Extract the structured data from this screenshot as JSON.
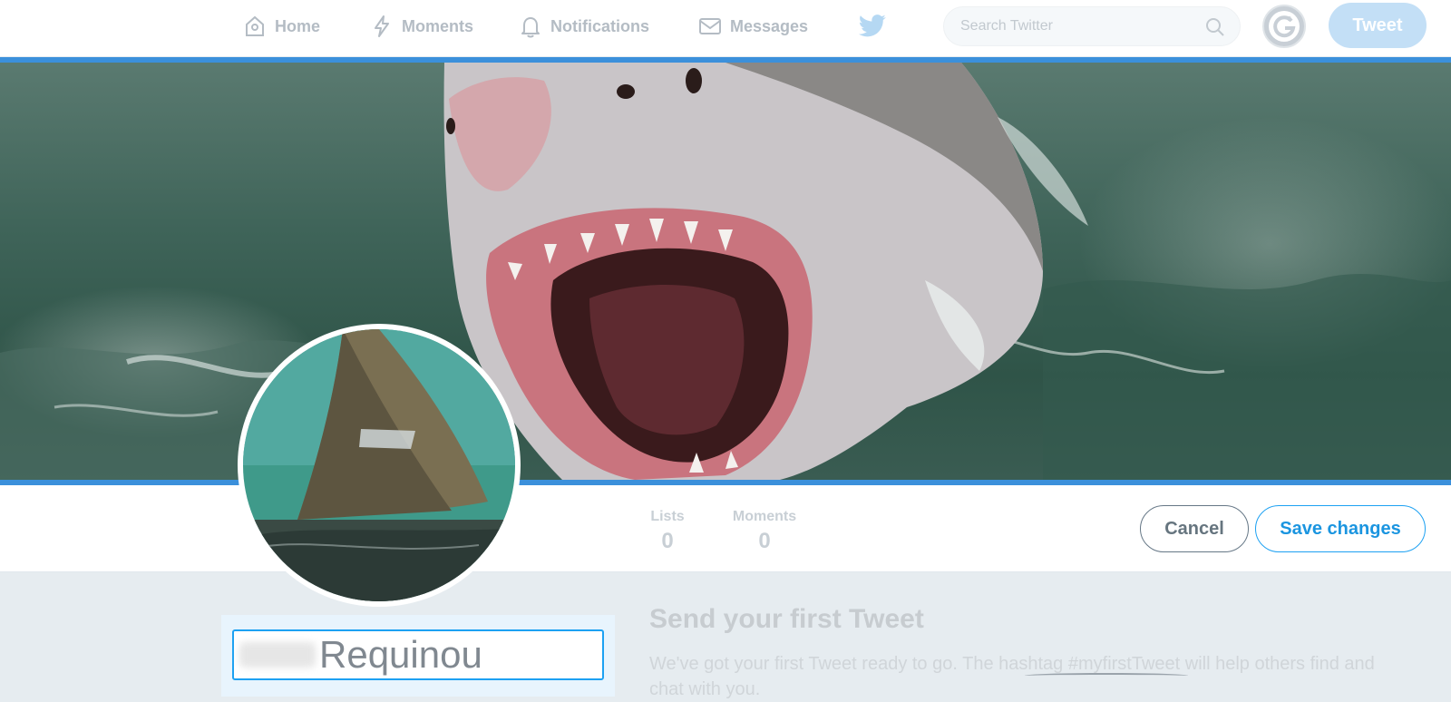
{
  "nav": {
    "items": [
      {
        "label": "Home",
        "icon": "home-icon"
      },
      {
        "label": "Moments",
        "icon": "lightning-icon"
      },
      {
        "label": "Notifications",
        "icon": "bell-icon"
      },
      {
        "label": "Messages",
        "icon": "envelope-icon"
      }
    ],
    "logo_icon": "twitter-bird-icon",
    "search_placeholder": "Search Twitter",
    "tweet_label": "Tweet"
  },
  "profile": {
    "stats": [
      {
        "label": "Lists",
        "value": "0"
      },
      {
        "label": "Moments",
        "value": "0"
      }
    ],
    "cancel_label": "Cancel",
    "save_label": "Save changes",
    "name_value": "Requinou"
  },
  "first_tweet": {
    "title": "Send your first Tweet",
    "description": "We've got your first Tweet ready to go. The hashtag #myfirstTweet will help others find and chat with you."
  },
  "colors": {
    "accent": "#1da1f2",
    "header_border": "#3b90db",
    "tweet_button": "#c3dff6"
  }
}
